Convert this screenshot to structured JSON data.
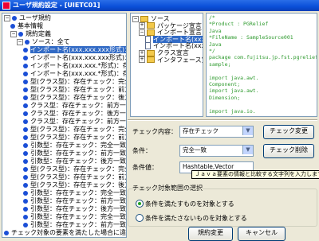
{
  "window": {
    "title": "ユーザ規約設定 - [UIETC01]",
    "icon": "app-icon"
  },
  "left_tree": {
    "items": [
      {
        "label": "ユーザ規約",
        "expander": "−",
        "icon": "blue-icon"
      },
      {
        "label": "基本情報",
        "expander": "",
        "icon": "blue-icon"
      },
      {
        "label": "規約定義",
        "expander": "−",
        "icon": "blue-icon"
      },
      {
        "label": "ソース：全て",
        "expander": "−",
        "icon": "blue-icon"
      },
      {
        "label": "インポート名(xxx.xxx.xxx形式)：存在",
        "expander": "",
        "icon": "blue-icon",
        "selected": true
      },
      {
        "label": "インポート名(xxx.xxx.xxx形式)：存在",
        "expander": "",
        "icon": "blue-icon"
      },
      {
        "label": "インポート名(xxx.xxx.*形式)：存在",
        "expander": "",
        "icon": "blue-icon"
      },
      {
        "label": "インポート名(xxx.xxx.*形式)：存在",
        "expander": "",
        "icon": "blue-icon"
      },
      {
        "label": "型(クラス型)：存在チェック：完全一",
        "expander": "",
        "icon": "blue-icon"
      },
      {
        "label": "型(クラス型)：存在チェック：前方一",
        "expander": "",
        "icon": "blue-icon"
      },
      {
        "label": "型(クラス型)：存在チェック：後方一",
        "expander": "",
        "icon": "blue-icon"
      },
      {
        "label": "クラス型：存在チェック：前方一致",
        "expander": "",
        "icon": "blue-icon"
      },
      {
        "label": "クラス型：存在チェック：後方一致",
        "expander": "",
        "icon": "blue-icon"
      },
      {
        "label": "クラス型：存在チェック：前方一致",
        "expander": "",
        "icon": "blue-icon"
      },
      {
        "label": "型(クラス型)：存在チェック：完全一",
        "expander": "",
        "icon": "blue-icon"
      },
      {
        "label": "型(クラス型)：存在チェック：前方一",
        "expander": "",
        "icon": "blue-icon"
      },
      {
        "label": "引数型：存在チェック：完全一致",
        "expander": "",
        "icon": "blue-icon"
      },
      {
        "label": "引数型：存在チェック：前方一致",
        "expander": "",
        "icon": "blue-icon"
      },
      {
        "label": "引数型：存在チェック：後方一致",
        "expander": "",
        "icon": "blue-icon"
      },
      {
        "label": "型(クラス型)：存在チェック：完全一",
        "expander": "",
        "icon": "blue-icon"
      },
      {
        "label": "型(クラス型)：存在チェック：前方一",
        "expander": "",
        "icon": "blue-icon"
      },
      {
        "label": "型(クラス型)：存在チェック：後方一",
        "expander": "",
        "icon": "blue-icon"
      },
      {
        "label": "引数型：存在チェック：完全一致",
        "expander": "",
        "icon": "blue-icon"
      },
      {
        "label": "引数型：存在チェック：前方一致",
        "expander": "",
        "icon": "blue-icon"
      },
      {
        "label": "引数型：存在チェック：後方一致",
        "expander": "",
        "icon": "blue-icon"
      },
      {
        "label": "引数型：存在チェック：完全一致",
        "expander": "",
        "icon": "blue-icon"
      },
      {
        "label": "引数型：存在チェック：前方一致",
        "expander": "",
        "icon": "blue-icon"
      },
      {
        "label": "チェック対象の要素を満たした場合に違反",
        "expander": "",
        "icon": "blue-icon"
      }
    ]
  },
  "source_tree": {
    "items": [
      {
        "label": "ソース",
        "expander": "−",
        "icon": "folder-icon"
      },
      {
        "label": "パッケージ宣言",
        "expander": "+",
        "icon": "folder-icon"
      },
      {
        "label": "インポート宣言",
        "expander": "−",
        "icon": "folder-icon"
      },
      {
        "label": "インポート名(xxx.xxx.xxx形",
        "expander": "",
        "icon": "doc-icon",
        "selected": true
      },
      {
        "label": "インポート名(xxx.xxx.*形",
        "expander": "",
        "icon": "doc-icon"
      },
      {
        "label": "クラス宣言",
        "expander": "+",
        "icon": "folder-icon"
      },
      {
        "label": "インタフェース宣言",
        "expander": "+",
        "icon": "folder-icon"
      }
    ]
  },
  "code": {
    "lines": [
      {
        "text": "/*",
        "kind": "com"
      },
      {
        "text": " *Product : PGRelief",
        "kind": "com"
      },
      {
        "text": " Java",
        "kind": "com"
      },
      {
        "text": " *FileName : SampleSource001",
        "kind": "com"
      },
      {
        "text": " Java",
        "kind": "com"
      },
      {
        "text": " */",
        "kind": "com"
      },
      {
        "text": "package com.fujitsu.jp.fst.pgrelief.java.",
        "kind": "com"
      },
      {
        "text": "sample;",
        "kind": "com"
      },
      {
        "text": "",
        "kind": "com"
      },
      {
        "text": "import java.awt.",
        "kind": "com"
      },
      {
        "text": "Component;",
        "kind": "com"
      },
      {
        "text": "import java.awt.",
        "kind": "com"
      },
      {
        "text": "Dimension;",
        "kind": "com"
      },
      {
        "text": "",
        "kind": "com"
      },
      {
        "text": "import java.io.",
        "kind": "com"
      }
    ]
  },
  "form": {
    "check_content_label": "チェック内容：",
    "check_content_value": "存在チェック",
    "check_change_button": "チェック変更",
    "condition_label": "条件：",
    "condition_value": "完全一致",
    "check_delete_button": "チェック削除",
    "condition_value_label": "条件値：",
    "condition_value_input": "Hashtable,Vector",
    "tooltip": "Ｊａｖａ要素の情報と比較する文字列を入力します",
    "scope_group_label": "チェック対象範囲の選択",
    "radio_satisfy": "条件を満たすものを対象とする",
    "radio_not_satisfy": "条件を満たさないものを対象とする",
    "rule_change_button": "規約変更",
    "cancel_button": "キャンセル"
  }
}
